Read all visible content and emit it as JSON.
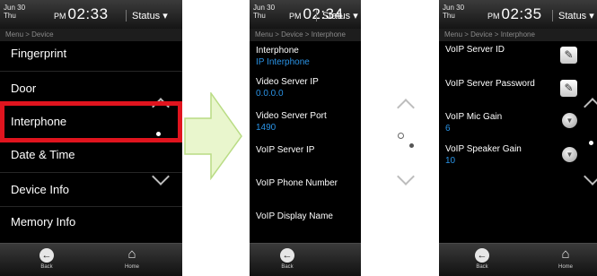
{
  "status_bar": {
    "date_month_day": "Jun  30",
    "weekday": "Thu",
    "ampm": "PM",
    "screen1_time": "02:33",
    "screen2_time": "02:34",
    "screen3_time": "02:35",
    "status_label": "Status ▾"
  },
  "screen1": {
    "breadcrumb": "Menu > Device",
    "items": [
      "Fingerprint",
      "Door",
      "Interphone",
      "Date & Time",
      "Device Info",
      "Memory Info"
    ]
  },
  "screen2": {
    "breadcrumb": "Menu > Device > Interphone",
    "interphone_label": "Interphone",
    "interphone_value": "IP Interphone",
    "video_server_ip_label": "Video Server IP",
    "video_server_ip_value": "0.0.0.0",
    "video_server_port_label": "Video Server Port",
    "video_server_port_value": "1490",
    "voip_server_ip_label": "VoIP Server IP",
    "voip_phone_number_label": "VoIP Phone Number",
    "voip_display_name_label": "VoIP Display Name"
  },
  "screen3": {
    "breadcrumb": "Menu > Device > Interphone",
    "voip_server_id_label": "VoIP Server ID",
    "voip_server_password_label": "VoIP Server Password",
    "voip_mic_gain_label": "VoIP Mic Gain",
    "voip_mic_gain_value": "6",
    "voip_speaker_gain_label": "VoIP Speaker Gain",
    "voip_speaker_gain_value": "10"
  },
  "bottom_bar": {
    "back_label": "Back",
    "home_label": "Home"
  },
  "icons": {
    "back": "arrow-left-circle-icon",
    "home": "house-icon",
    "edit": "pencil-icon",
    "dropdown": "chevron-down-circle-icon",
    "flow_arrow": "right-arrow-icon"
  },
  "colors": {
    "highlight": "#e0141e",
    "value_text": "#2a93e6",
    "arrow_fill": "#e9f6cd",
    "arrow_stroke": "#b9dc84"
  }
}
